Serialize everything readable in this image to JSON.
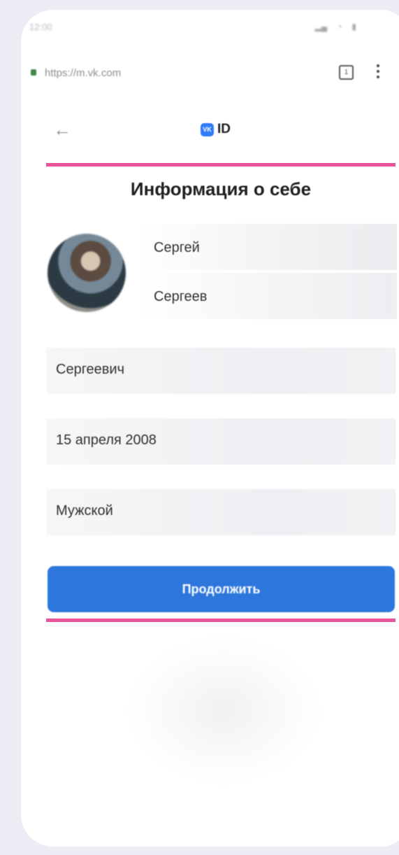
{
  "status_bar": {
    "time": "12:00",
    "icons": [
      "signal-icon",
      "wifi-icon",
      "battery-icon"
    ]
  },
  "browser": {
    "url": "https://m.vk.com",
    "tabs_count": "1",
    "menu_icon": "menu-icon"
  },
  "header": {
    "back_icon": "back-arrow-icon",
    "logo_badge": "VK",
    "logo_text": "ID"
  },
  "form": {
    "title": "Информация о себе",
    "first_name": "Сергей",
    "last_name": "Сергеев",
    "middle_name": "Сергеевич",
    "birthday": "15 апреля 2008",
    "gender": "Мужской",
    "continue_label": "Продолжить"
  },
  "colors": {
    "background": "#eeedf6",
    "accent": "#2d76db",
    "highlight": "#e8559a"
  }
}
